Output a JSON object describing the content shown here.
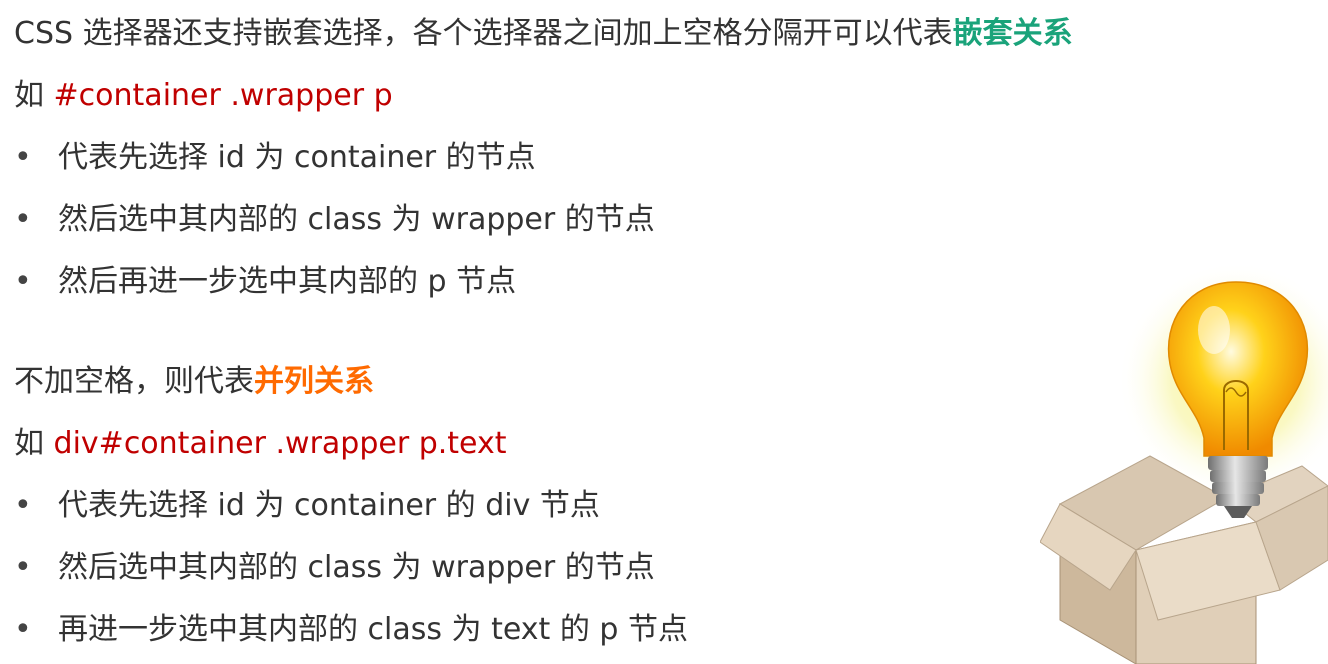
{
  "section1": {
    "intro_text": "CSS 选择器还支持嵌套选择，各个选择器之间加上空格分隔开可以代表",
    "intro_highlight": "嵌套关系",
    "example_prefix": "如 ",
    "example_code": "#container .wrapper p",
    "bullets": [
      "代表先选择 id 为 container 的节点",
      "然后选中其内部的 class 为 wrapper 的节点",
      "然后再进一步选中其内部的 p 节点"
    ]
  },
  "section2": {
    "intro_text": "不加空格，则代表",
    "intro_highlight": "并列关系",
    "example_prefix": "如 ",
    "example_code": "div#container .wrapper p.text",
    "bullets": [
      "代表先选择 id 为 container 的 div 节点",
      "然后选中其内部的 class 为 wrapper 的节点",
      "再进一步选中其内部的 class 为 text 的 p 节点"
    ]
  },
  "bullet_symbol": "•",
  "illustration": {
    "icon": "lightbulb-in-box-icon"
  },
  "colors": {
    "text": "#333333",
    "code": "#c00000",
    "highlight_green": "#1aa37a",
    "highlight_orange": "#ff6a00"
  }
}
